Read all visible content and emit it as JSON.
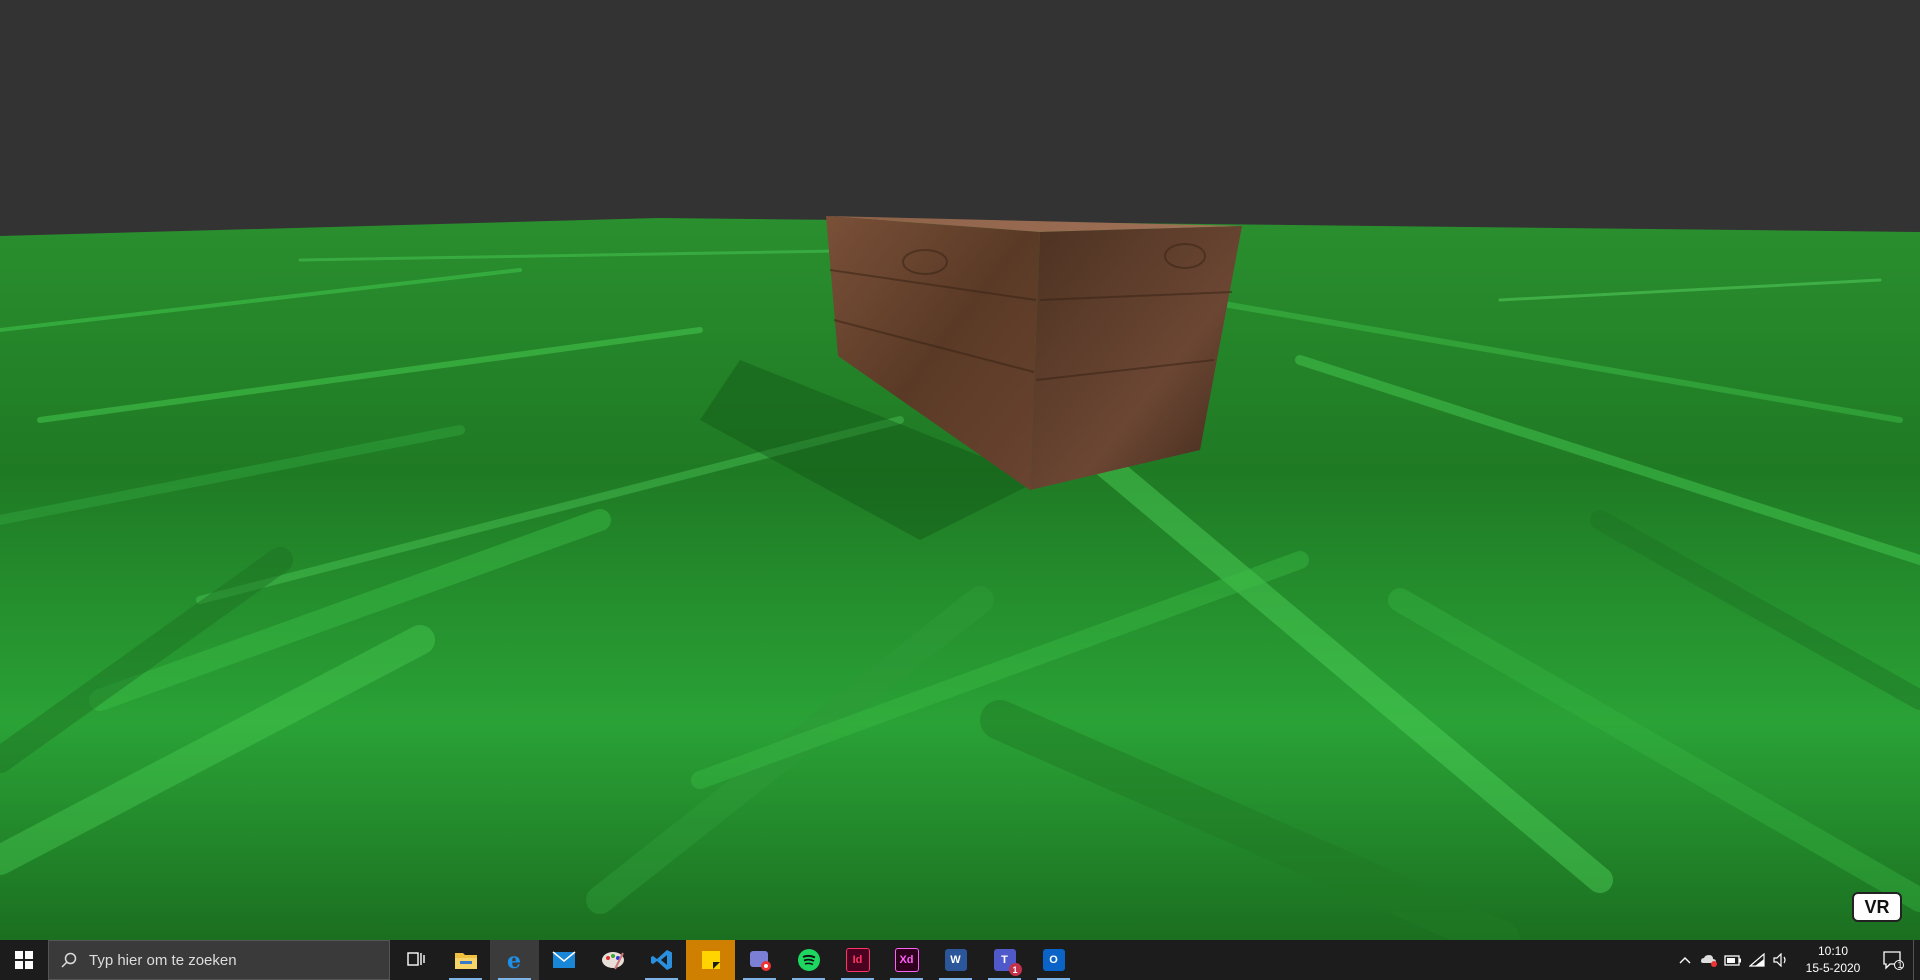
{
  "scene": {
    "sky_color": "#333333",
    "grass_color": "#2e9e34",
    "object": "wooden-crate",
    "vr_label": "VR"
  },
  "taskbar": {
    "search_placeholder": "Typ hier om te zoeken",
    "apps": [
      {
        "name": "task-view",
        "icon": "task-view-icon"
      },
      {
        "name": "file-explorer",
        "icon": "folder-icon",
        "running": true
      },
      {
        "name": "edge",
        "icon": "edge-icon",
        "running": true,
        "active": true
      },
      {
        "name": "mail",
        "icon": "mail-icon"
      },
      {
        "name": "paint",
        "icon": "paint-palette-icon"
      },
      {
        "name": "vscode",
        "icon": "vscode-icon",
        "running": true
      },
      {
        "name": "sticky-notes",
        "icon": "sticky-notes-icon",
        "highlight": true
      },
      {
        "name": "snip-sketch",
        "icon": "snip-icon",
        "running": true
      },
      {
        "name": "spotify",
        "icon": "spotify-icon",
        "running": true
      },
      {
        "name": "indesign",
        "icon": "indesign-icon",
        "label": "Id",
        "running": true
      },
      {
        "name": "adobe-xd",
        "icon": "xd-icon",
        "label": "Xd",
        "running": true
      },
      {
        "name": "word",
        "icon": "word-icon",
        "label": "W",
        "running": true
      },
      {
        "name": "teams",
        "icon": "teams-icon",
        "label": "T",
        "badge": "1",
        "running": true
      },
      {
        "name": "outlook",
        "icon": "outlook-icon",
        "label": "O",
        "running": true
      }
    ],
    "time": "10:10",
    "date": "15-5-2020",
    "notification_count": "1"
  }
}
